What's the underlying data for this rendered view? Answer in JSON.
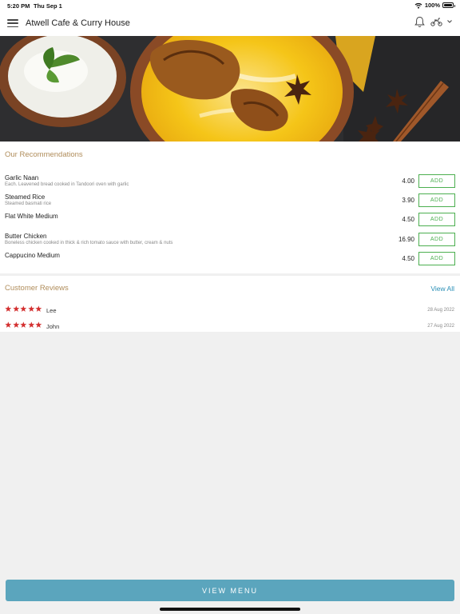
{
  "status_bar": {
    "time": "5:20 PM",
    "date": "Thu Sep 1",
    "battery": "100%"
  },
  "header": {
    "title": "Atwell Cafe & Curry House",
    "icons": [
      "menu-icon",
      "bell-icon",
      "scooter-icon",
      "chevron-down-icon"
    ]
  },
  "hero": {
    "icon": "biryani-food-image"
  },
  "recommendations": {
    "title": "Our Recommendations",
    "items": [
      {
        "name": "Garlic Naan",
        "description": "Each. Leavened bread cooked in Tandoori oven with garlic",
        "price": "4.00",
        "button": "ADD"
      },
      {
        "name": "Steamed Rice",
        "description": "Steamed basmati rice",
        "price": "3.90",
        "button": "ADD"
      },
      {
        "name": "Flat White Medium",
        "description": "",
        "price": "4.50",
        "button": "ADD"
      },
      {
        "name": "Butter Chicken",
        "description": "Boneless chicken cooked in thick & rich tomato sauce with butter, cream & nuts",
        "price": "16.90",
        "button": "ADD"
      },
      {
        "name": "Cappucino Medium",
        "description": "",
        "price": "4.50",
        "button": "ADD"
      }
    ]
  },
  "reviews": {
    "title": "Customer Reviews",
    "view_all": "View All",
    "items": [
      {
        "name": "Lee",
        "date": "28 Aug 2022",
        "rating": 5
      },
      {
        "name": "John",
        "date": "27 Aug 2022",
        "rating": 5
      }
    ]
  },
  "footer": {
    "view_menu": "VIEW MENU"
  },
  "colors": {
    "accent": "#5ba5bd",
    "section_title": "#b08d5b",
    "add_border": "#4caf50",
    "star": "#d32f2f",
    "link": "#2a8fb6"
  }
}
